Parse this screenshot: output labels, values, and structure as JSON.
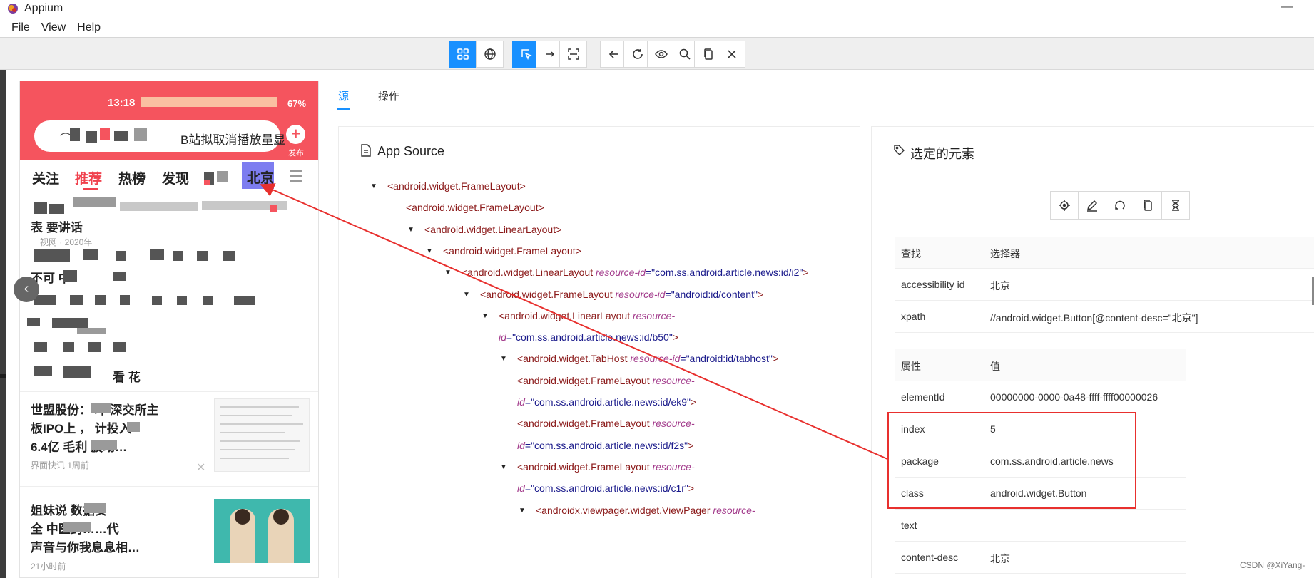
{
  "window": {
    "title": "Appium",
    "minimize": "—"
  },
  "menu": {
    "items": [
      "File",
      "View",
      "Help"
    ]
  },
  "toolbar": {
    "buttons": [
      {
        "icon": "grid-icon",
        "active": true
      },
      {
        "icon": "globe-icon",
        "active": false
      },
      {
        "icon": "select-element-icon",
        "active": true
      },
      {
        "icon": "swipe-icon",
        "active": false
      },
      {
        "icon": "tap-coordinates-icon",
        "active": false
      },
      {
        "icon": "back-icon",
        "active": false
      },
      {
        "icon": "refresh-icon",
        "active": false
      },
      {
        "icon": "eye-icon",
        "active": false
      },
      {
        "icon": "search-icon",
        "active": false
      },
      {
        "icon": "copy-icon",
        "active": false
      },
      {
        "icon": "close-icon",
        "active": false
      }
    ],
    "accent": "#1890ff"
  },
  "phone": {
    "time": "13:18",
    "battery": "67%",
    "search_text": "B站拟取消播放量显",
    "publish": "发布",
    "tabs": [
      "关注",
      "推荐",
      "热榜",
      "发现",
      "北京"
    ],
    "active_tab": "推荐",
    "highlighted_tab": "北京",
    "feed": [
      {
        "title": "表  要讲话",
        "meta": "视网 · 2020年"
      },
      {
        "title": "不可   中  ",
        "meta": ""
      },
      {
        "title": "看    花",
        "meta": ""
      },
      {
        "title_lines": [
          "世盟股份：  冲    深交所主",
          "板IPO上  ，  计投入   ",
          "6.4亿         毛利   波动…"
        ],
        "meta": "界面快讯  1周前"
      },
      {
        "title_lines": [
          "姐妹说        数据安",
          "全          中医药……代",
          "      声音与你我息息相…"
        ],
        "meta": "   21小时前"
      }
    ],
    "brand_color": "#f5545e"
  },
  "tabs": {
    "source": "源",
    "actions": "操作"
  },
  "app_source": {
    "title": "App Source",
    "lines": [
      {
        "caret": true,
        "tag": "<android.widget.FrameLayout>",
        "attr": "",
        "val": "",
        "tail": ""
      },
      {
        "caret": false,
        "tag": "<android.widget.FrameLayout>",
        "attr": "",
        "val": "",
        "tail": ""
      },
      {
        "caret": true,
        "tag": "<android.widget.LinearLayout>",
        "attr": "",
        "val": "",
        "tail": ""
      },
      {
        "caret": true,
        "tag": "<android.widget.FrameLayout>",
        "attr": "",
        "val": "",
        "tail": ""
      },
      {
        "caret": true,
        "tag": "<android.widget.LinearLayout ",
        "attr": "resource-id",
        "val": "=\"com.ss.android.article.news:id/i2\"",
        "tail": ">"
      },
      {
        "caret": true,
        "tag": "<android.widget.FrameLayout ",
        "attr": "resource-id",
        "val": "=\"android:id/content\"",
        "tail": ">"
      },
      {
        "caret": true,
        "tag": "<android.widget.LinearLayout ",
        "attr": "resource-",
        "val": "",
        "tail": ""
      },
      {
        "caret": false,
        "tag": "",
        "attr": "id",
        "val": "=\"com.ss.android.article.news:id/b50\"",
        "tail": ">"
      },
      {
        "caret": true,
        "tag": "<android.widget.TabHost ",
        "attr": "resource-id",
        "val": "=\"android:id/tabhost\"",
        "tail": ">"
      },
      {
        "caret": false,
        "tag": "<android.widget.FrameLayout ",
        "attr": "resource-",
        "val": "",
        "tail": ""
      },
      {
        "caret": false,
        "tag": "",
        "attr": "id",
        "val": "=\"com.ss.android.article.news:id/ek9\"",
        "tail": ">"
      },
      {
        "caret": false,
        "tag": "<android.widget.FrameLayout ",
        "attr": "resource-",
        "val": "",
        "tail": ""
      },
      {
        "caret": false,
        "tag": "",
        "attr": "id",
        "val": "=\"com.ss.android.article.news:id/f2s\"",
        "tail": ">"
      },
      {
        "caret": true,
        "tag": "<android.widget.FrameLayout ",
        "attr": "resource-",
        "val": "",
        "tail": ""
      },
      {
        "caret": false,
        "tag": "",
        "attr": "id",
        "val": "=\"com.ss.android.article.news:id/c1r\"",
        "tail": ">"
      },
      {
        "caret": true,
        "tag": "<androidx.viewpager.widget.ViewPager ",
        "attr": "resource-",
        "val": "",
        "tail": ""
      }
    ]
  },
  "selected": {
    "title": "选定的元素",
    "action_icons": [
      "tap-icon",
      "edit-icon",
      "reset-icon",
      "copy-icon",
      "timer-icon"
    ],
    "selector_header": [
      "查找",
      "选择器"
    ],
    "selectors": [
      [
        "accessibility id",
        "北京"
      ],
      [
        "xpath",
        "//android.widget.Button[@content-desc=\"北京\"]"
      ]
    ],
    "attr_header": [
      "属性",
      "值"
    ],
    "attributes": [
      [
        "elementId",
        "00000000-0000-0a48-ffff-ffff00000026"
      ],
      [
        "index",
        "5"
      ],
      [
        "package",
        "com.ss.android.article.news"
      ],
      [
        "class",
        "android.widget.Button"
      ],
      [
        "text",
        ""
      ],
      [
        "content-desc",
        "北京"
      ]
    ],
    "highlight_color": "#e8302e"
  },
  "watermark": "CSDN @XiYang-"
}
